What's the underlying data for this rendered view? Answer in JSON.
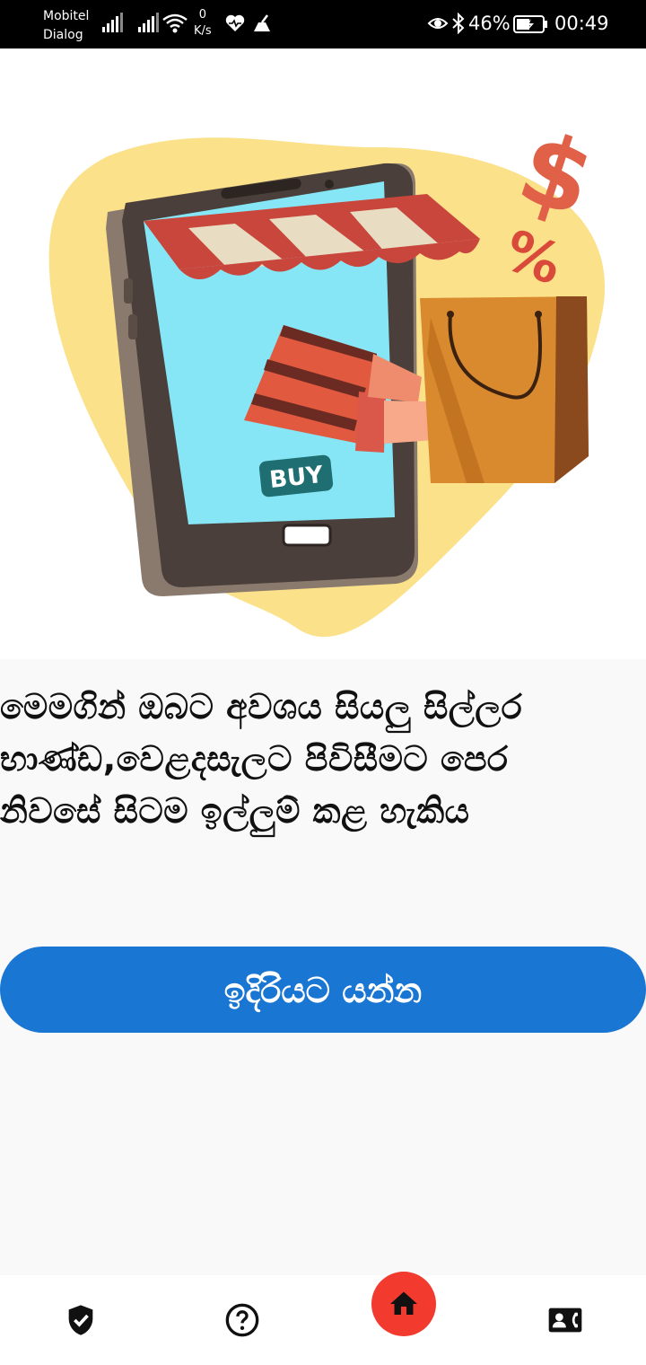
{
  "status_bar": {
    "carrier_1": "Mobitel",
    "carrier_2": "Dialog",
    "net_speed_value": "0",
    "net_speed_unit": "K/s",
    "battery_percent": "46%",
    "time": "00:49"
  },
  "hero": {
    "buy_sign": "BUY",
    "dollar_symbol": "$",
    "percent_symbol": "%"
  },
  "description": {
    "lines": [
      "මෙමගින් ඔබට අවශය සියලු සිල්ලර",
      "භාණ්ඩ,වෙළදසැලට පිවිසීමට පෙර",
      "නිවසේ සිටම ඉල්ලුම් කළ හැකිය"
    ]
  },
  "next_button": {
    "label": "ඉදිරියට යන්න"
  },
  "bottom_nav": {
    "items": [
      {
        "icon": "shield-check-icon"
      },
      {
        "icon": "help-circle-icon"
      },
      {
        "icon": "home-icon",
        "active_color": "#f23a2e"
      },
      {
        "icon": "contact-phone-icon"
      }
    ]
  },
  "colors": {
    "primary": "#1976d2",
    "accent": "#f23a2e",
    "blob": "#fbe18a"
  }
}
